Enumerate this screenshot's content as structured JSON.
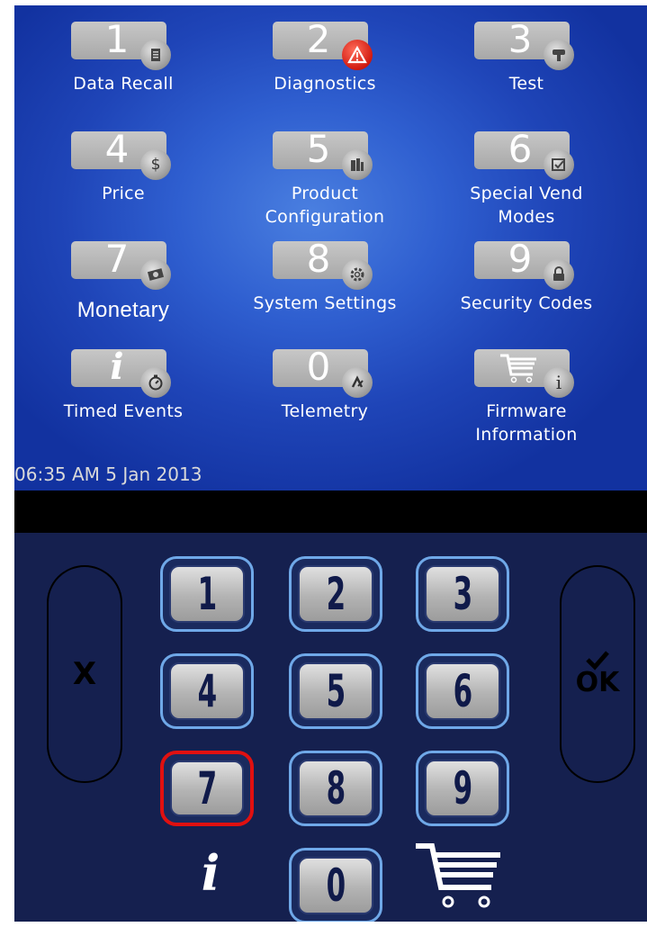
{
  "menu": [
    {
      "digit": "1",
      "label": "Data Recall",
      "icon": "clipboard-icon"
    },
    {
      "digit": "2",
      "label": "Diagnostics",
      "icon": "warning-icon"
    },
    {
      "digit": "3",
      "label": "Test",
      "icon": "test-icon"
    },
    {
      "digit": "4",
      "label": "Price",
      "icon": "dollar-icon",
      "badge_text": "$"
    },
    {
      "digit": "5",
      "label_line1": "Product",
      "label_line2": "Configuration",
      "icon": "product-icon"
    },
    {
      "digit": "6",
      "label_line1": "Special Vend",
      "label_line2": "Modes",
      "icon": "checkbox-icon"
    },
    {
      "digit": "7",
      "label": "Monetary",
      "icon": "money-icon"
    },
    {
      "digit": "8",
      "label": "System Settings",
      "icon": "gear-icon"
    },
    {
      "digit": "9",
      "label": "Security Codes",
      "icon": "lock-icon"
    },
    {
      "digit": "i",
      "label": "Timed Events",
      "icon": "stopwatch-icon"
    },
    {
      "digit": "0",
      "label": "Telemetry",
      "icon": "telemetry-icon"
    },
    {
      "digit": "",
      "label_line1": "Firmware",
      "label_line2": "Information",
      "icon": "info-icon",
      "tile_icon": "cart-icon",
      "badge_text": "i"
    }
  ],
  "status": {
    "datetime": "06:35 AM 5 Jan 2013"
  },
  "keypad": {
    "keys": [
      "1",
      "2",
      "3",
      "4",
      "5",
      "6",
      "7",
      "8",
      "9",
      "0"
    ],
    "selected_key": "7",
    "cancel_label": "X",
    "ok_label": "OK",
    "info_label": "i"
  },
  "colors": {
    "screen_bg": "#2f5fd0",
    "keypad_bg": "#15204f",
    "key_border": "#6fa8e8",
    "selected_border": "#e01010"
  }
}
